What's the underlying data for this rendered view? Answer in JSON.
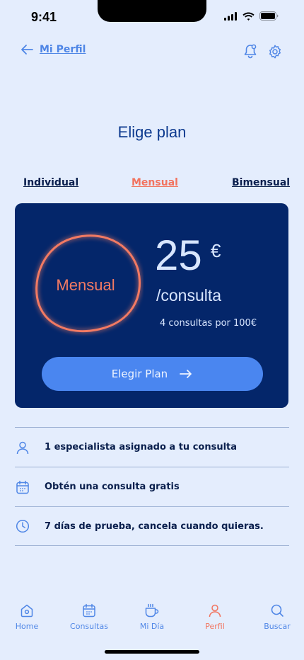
{
  "status_bar": {
    "time": "9:41"
  },
  "header": {
    "back_label": "Mi Perfil",
    "icons": [
      "bell-icon",
      "gear-icon"
    ]
  },
  "page": {
    "title": "Elige plan"
  },
  "tabs": [
    {
      "label": "Individual",
      "active": false
    },
    {
      "label": "Mensual",
      "active": true
    },
    {
      "label": "Bimensual",
      "active": false
    }
  ],
  "plan": {
    "name": "Mensual",
    "price": "25",
    "currency": "€",
    "unit": "/consulta",
    "detail": "4 consultas por 100€",
    "cta_label": "Elegir Plan"
  },
  "features": [
    {
      "icon": "user-icon",
      "text": "1 especialista asignado a tu consulta"
    },
    {
      "icon": "calendar-icon",
      "text": "Obtén una consulta gratis"
    },
    {
      "icon": "clock-icon",
      "text": "7 días de prueba, cancela cuando quieras."
    }
  ],
  "bottom_nav": [
    {
      "label": "Home",
      "icon": "home-icon",
      "active": false
    },
    {
      "label": "Consultas",
      "icon": "calendar-icon",
      "active": false
    },
    {
      "label": "Mi Día",
      "icon": "cup-icon",
      "active": false
    },
    {
      "label": "Perfil",
      "icon": "user-icon",
      "active": true
    },
    {
      "label": "Buscar",
      "icon": "search-icon",
      "active": false
    }
  ],
  "colors": {
    "accent": "#4a86f0",
    "active": "#f2735e",
    "card": "#04266a",
    "background": "#e4edfd"
  }
}
